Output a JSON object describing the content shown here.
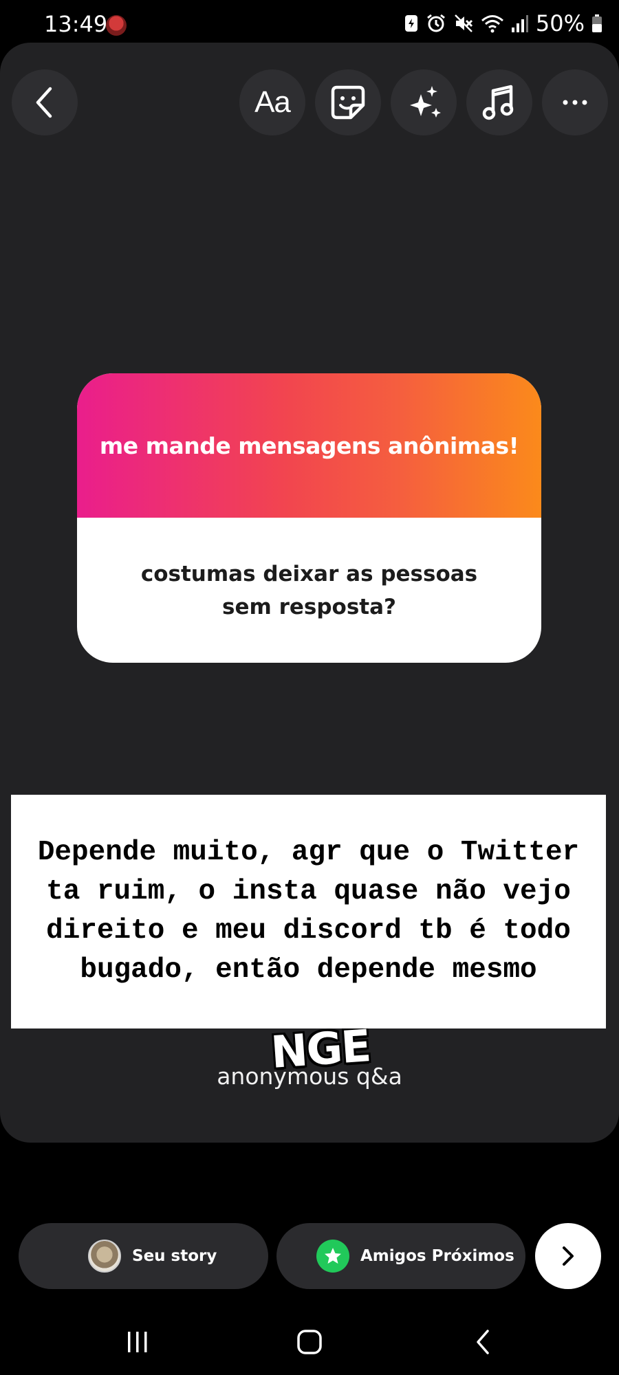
{
  "status_bar": {
    "time": "13:49",
    "battery_percent": "50%",
    "icons": [
      "avatar-icon",
      "data-saver-icon",
      "alarm-icon",
      "mute-icon",
      "wifi-icon",
      "signal-icon",
      "battery-icon"
    ]
  },
  "toolbar": {
    "back_icon": "chevron-left-icon",
    "text_tool_label": "Aa",
    "tools": [
      "text-tool",
      "sticker-icon",
      "effects-sparkle-icon",
      "music-note-icon",
      "more-dots-icon"
    ]
  },
  "question_sticker": {
    "title": "me mande mensagens anônimas!",
    "question": "costumas deixar as pessoas sem resposta?",
    "gradient_colors": [
      "#ea1e8c",
      "#f2454f",
      "#fb8a1b"
    ]
  },
  "answer": {
    "text": "Depende muito, agr que o Twitter ta ruim, o insta quase não vejo direito e meu discord tb é todo bugado, então depende mesmo"
  },
  "partial_sticker": {
    "text": "NGE"
  },
  "caption": "anonymous q&a",
  "share_bar": {
    "your_story_label": "Seu story",
    "close_friends_label": "Amigos Próximos",
    "close_friends_color": "#21c95a",
    "next_icon": "chevron-right-icon"
  },
  "nav_bar": {
    "buttons": [
      "recent-apps-icon",
      "home-icon",
      "back-icon"
    ]
  },
  "colors": {
    "canvas_bg": "#222224",
    "screen_bg": "#000000",
    "button_bg": "#2e2e31"
  }
}
